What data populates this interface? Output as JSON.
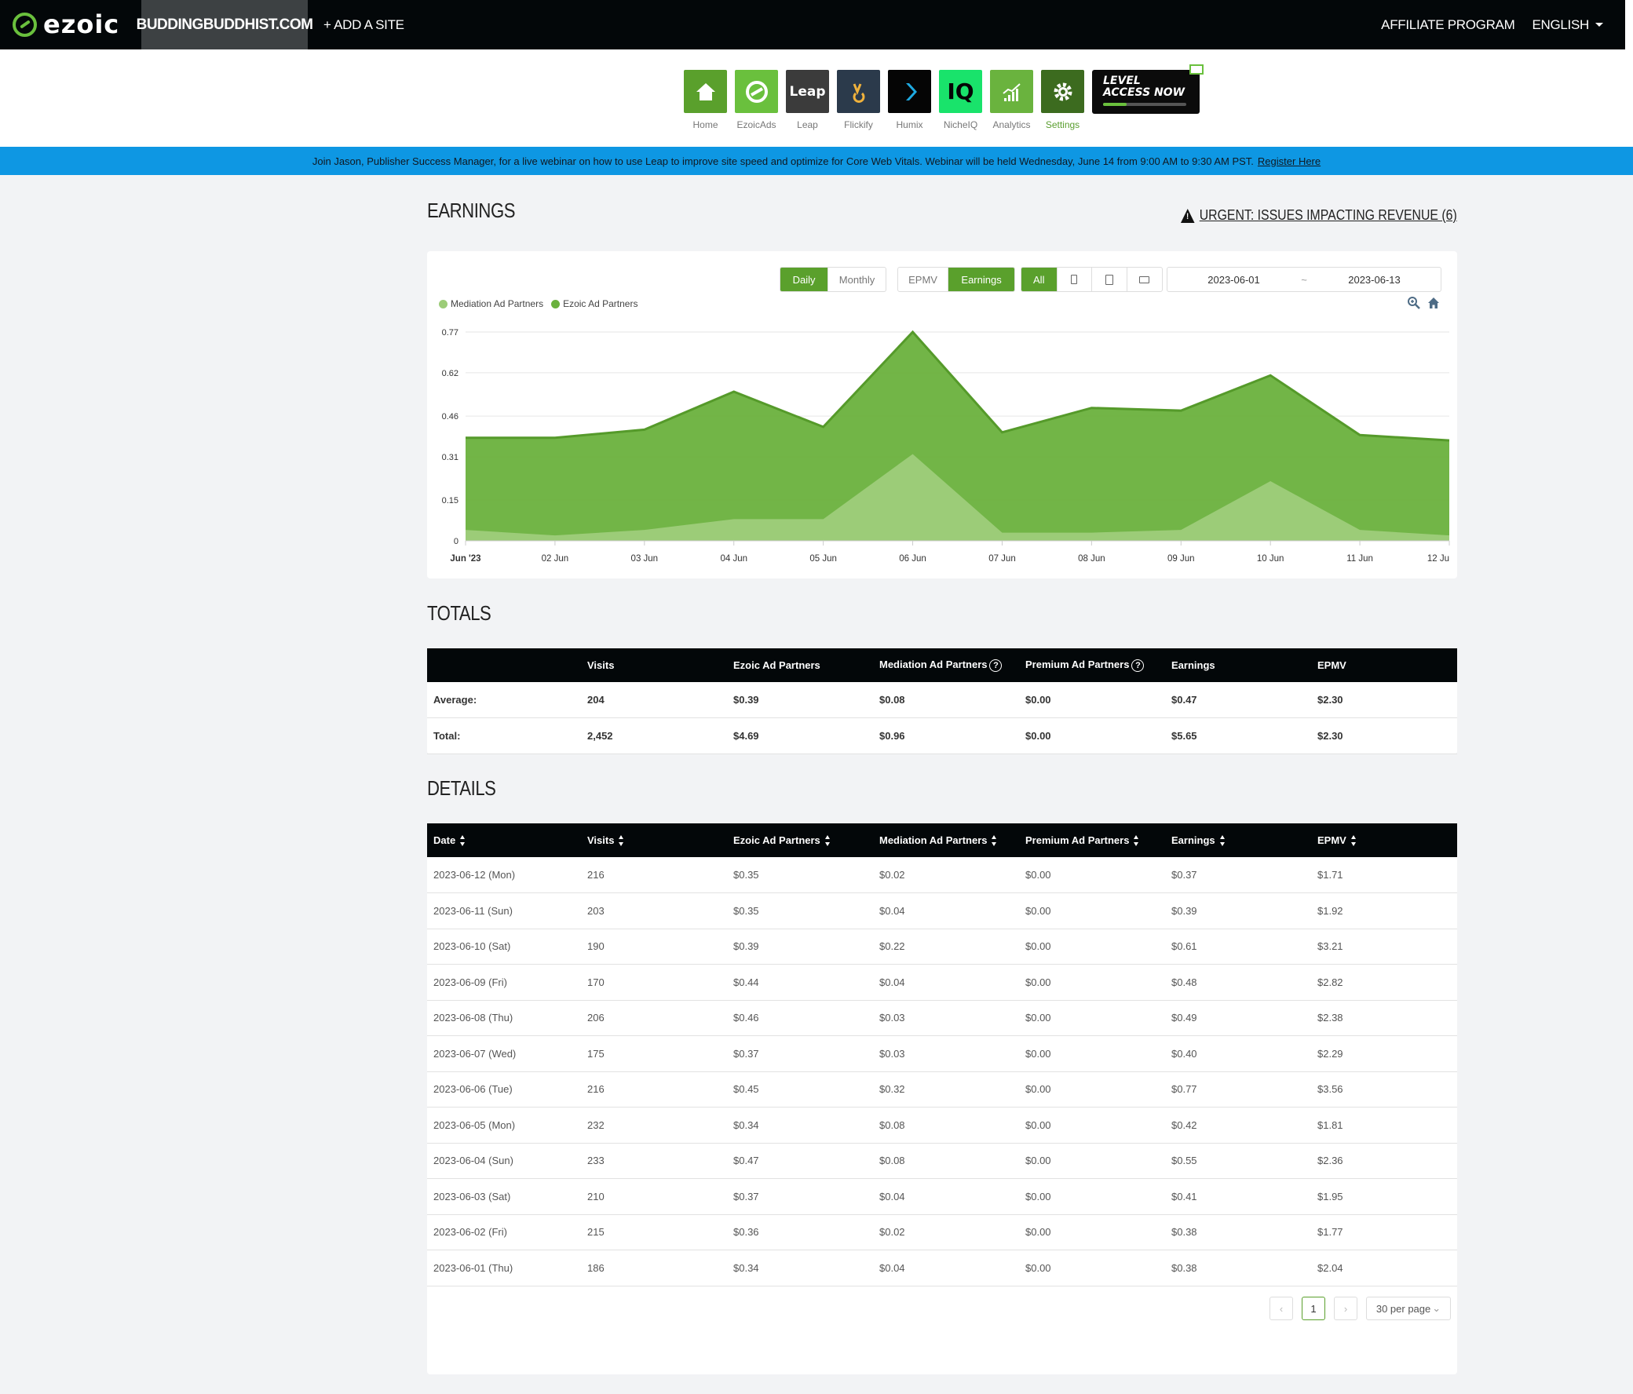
{
  "topbar": {
    "logo_text": "ezoic",
    "site": "BUDDINGBUDDHIST.COM",
    "add_site": "+ ADD A SITE",
    "affiliate": "AFFILIATE PROGRAM",
    "language": "ENGLISH"
  },
  "apps": [
    {
      "label": "Home",
      "icon": "home-icon",
      "color": "#5aa02c"
    },
    {
      "label": "EzoicAds",
      "icon": "ezoic-ads-icon",
      "color": "#6ac03d"
    },
    {
      "label": "Leap",
      "icon": "leap-icon",
      "color": "#3b3b3b",
      "text": "Leap"
    },
    {
      "label": "Flickify",
      "icon": "flickify-icon",
      "color": "#2b3a4b"
    },
    {
      "label": "Humix",
      "icon": "humix-icon",
      "color": "#050505"
    },
    {
      "label": "NicheIQ",
      "icon": "nicheiq-icon",
      "color": "#19e36b",
      "text": "IQ"
    },
    {
      "label": "Analytics",
      "icon": "analytics-icon",
      "color": "#6ab33e"
    },
    {
      "label": "Settings",
      "icon": "gear-icon",
      "color": "#3c6b1f"
    }
  ],
  "level_button": {
    "line1": "LEVEL",
    "line2": "ACCESS NOW"
  },
  "banner": {
    "text": "Join Jason, Publisher Success Manager, for a live webinar on how to use Leap to improve site speed and optimize for Core Web Vitals. Webinar will be held Wednesday, June 14 from 9:00 AM to 9:30 AM PST.",
    "link": "Register Here"
  },
  "earnings": {
    "title": "EARNINGS",
    "urgent": "URGENT: ISSUES IMPACTING REVENUE (6)",
    "period_buttons": [
      "Daily",
      "Monthly"
    ],
    "metric_buttons": [
      "EPMV",
      "Earnings"
    ],
    "device_all": "All",
    "date_start": "2023-06-01",
    "date_sep": "~",
    "date_end": "2023-06-13"
  },
  "chart_data": {
    "type": "area",
    "stacked": true,
    "x": [
      "Jun '23",
      "02 Jun",
      "03 Jun",
      "04 Jun",
      "05 Jun",
      "06 Jun",
      "07 Jun",
      "08 Jun",
      "09 Jun",
      "10 Jun",
      "11 Jun",
      "12 Ju"
    ],
    "yticks": [
      "0",
      "0.15",
      "0.31",
      "0.46",
      "0.62",
      "0.77"
    ],
    "ylim": [
      0,
      0.77
    ],
    "series": [
      {
        "name": "Mediation Ad Partners",
        "color": "#9ccc78",
        "values": [
          0.04,
          0.02,
          0.04,
          0.08,
          0.08,
          0.32,
          0.03,
          0.03,
          0.04,
          0.22,
          0.04,
          0.02
        ]
      },
      {
        "name": "Ezoic Ad Partners",
        "color": "#6ab13d",
        "values": [
          0.34,
          0.36,
          0.37,
          0.47,
          0.34,
          0.45,
          0.37,
          0.46,
          0.44,
          0.39,
          0.35,
          0.35
        ]
      }
    ]
  },
  "totals": {
    "title": "TOTALS",
    "headers": [
      "",
      "Visits",
      "Ezoic Ad Partners",
      "Mediation Ad Partners",
      "Premium Ad Partners",
      "Earnings",
      "EPMV"
    ],
    "rows": [
      [
        "Average:",
        "204",
        "$0.39",
        "$0.08",
        "$0.00",
        "$0.47",
        "$2.30"
      ],
      [
        "Total:",
        "2,452",
        "$4.69",
        "$0.96",
        "$0.00",
        "$5.65",
        "$2.30"
      ]
    ]
  },
  "details": {
    "title": "DETAILS",
    "headers": [
      "Date",
      "Visits",
      "Ezoic Ad Partners",
      "Mediation Ad Partners",
      "Premium Ad Partners",
      "Earnings",
      "EPMV"
    ],
    "rows": [
      [
        "2023-06-12 (Mon)",
        "216",
        "$0.35",
        "$0.02",
        "$0.00",
        "$0.37",
        "$1.71"
      ],
      [
        "2023-06-11 (Sun)",
        "203",
        "$0.35",
        "$0.04",
        "$0.00",
        "$0.39",
        "$1.92"
      ],
      [
        "2023-06-10 (Sat)",
        "190",
        "$0.39",
        "$0.22",
        "$0.00",
        "$0.61",
        "$3.21"
      ],
      [
        "2023-06-09 (Fri)",
        "170",
        "$0.44",
        "$0.04",
        "$0.00",
        "$0.48",
        "$2.82"
      ],
      [
        "2023-06-08 (Thu)",
        "206",
        "$0.46",
        "$0.03",
        "$0.00",
        "$0.49",
        "$2.38"
      ],
      [
        "2023-06-07 (Wed)",
        "175",
        "$0.37",
        "$0.03",
        "$0.00",
        "$0.40",
        "$2.29"
      ],
      [
        "2023-06-06 (Tue)",
        "216",
        "$0.45",
        "$0.32",
        "$0.00",
        "$0.77",
        "$3.56"
      ],
      [
        "2023-06-05 (Mon)",
        "232",
        "$0.34",
        "$0.08",
        "$0.00",
        "$0.42",
        "$1.81"
      ],
      [
        "2023-06-04 (Sun)",
        "233",
        "$0.47",
        "$0.08",
        "$0.00",
        "$0.55",
        "$2.36"
      ],
      [
        "2023-06-03 (Sat)",
        "210",
        "$0.37",
        "$0.04",
        "$0.00",
        "$0.41",
        "$1.95"
      ],
      [
        "2023-06-02 (Fri)",
        "215",
        "$0.36",
        "$0.02",
        "$0.00",
        "$0.38",
        "$1.77"
      ],
      [
        "2023-06-01 (Thu)",
        "186",
        "$0.34",
        "$0.04",
        "$0.00",
        "$0.38",
        "$2.04"
      ]
    ],
    "pager": {
      "prev": "‹",
      "current": "1",
      "next": "›",
      "per_page": "30 per page"
    }
  }
}
